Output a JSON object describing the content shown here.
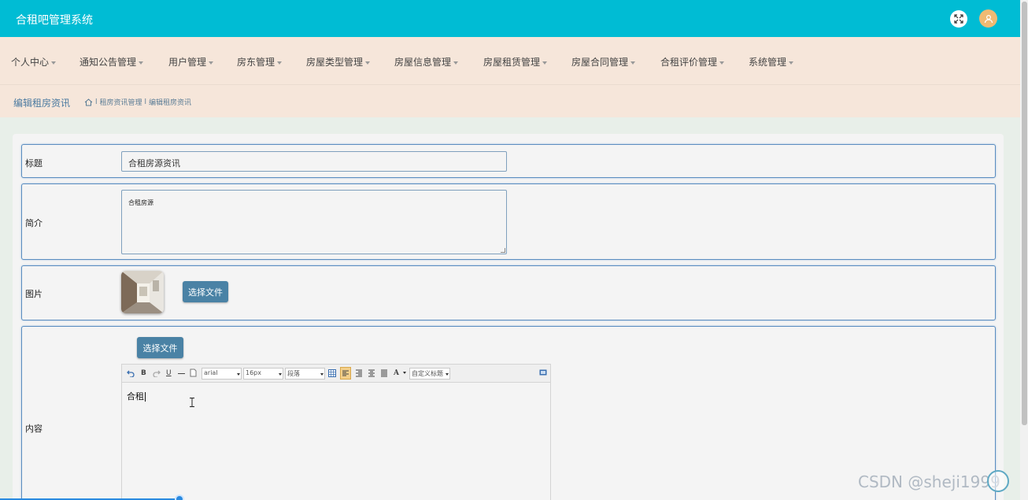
{
  "app": {
    "title": "合租吧管理系统",
    "header_color": "#00bcd4",
    "icons": {
      "fullscreen": "fullscreen-icon",
      "avatar": "user-avatar-icon"
    }
  },
  "nav": {
    "items": [
      {
        "label": "个人中心"
      },
      {
        "label": "通知公告管理"
      },
      {
        "label": "用户管理"
      },
      {
        "label": "房东管理"
      },
      {
        "label": "房屋类型管理"
      },
      {
        "label": "房屋信息管理"
      },
      {
        "label": "房屋租赁管理"
      },
      {
        "label": "房屋合同管理"
      },
      {
        "label": "合租评价管理"
      },
      {
        "label": "系统管理"
      }
    ]
  },
  "breadcrumb": {
    "page_title": "编辑租房资讯",
    "sep": "l",
    "level1": "租房资讯管理",
    "level2": "编辑租房资讯",
    "home_icon": "home-icon"
  },
  "form": {
    "title": {
      "label": "标题",
      "value": "合租房源资讯"
    },
    "intro": {
      "label": "简介",
      "value": "合租房源"
    },
    "image": {
      "label": "图片",
      "button": "选择文件"
    },
    "content": {
      "label": "内容",
      "button": "选择文件",
      "editor_text": "合租",
      "toolbar": {
        "bold": "B",
        "underline": "U",
        "font_family": "arial",
        "font_size": "16px",
        "paragraph": "段落",
        "font_color": "A",
        "custom_title": "自定义标题"
      }
    }
  },
  "watermark": "CSDN @sheji1999"
}
